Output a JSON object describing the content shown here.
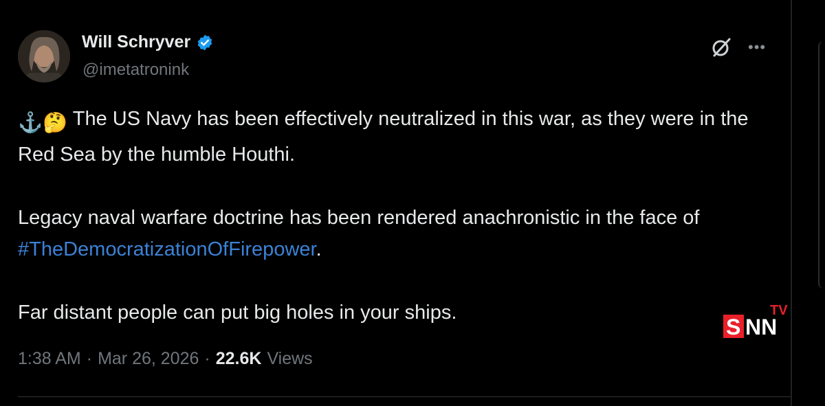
{
  "author": {
    "display_name": "Will Schryver",
    "handle": "@imetatronink",
    "verified_color": "#1d9bf0"
  },
  "tweet": {
    "lead_emojis": "⚓🤔",
    "paragraph1_text": " The US Navy has been effectively neutralized in this war, as they were in the Red Sea by the humble Houthi.",
    "paragraph2_before": "Legacy naval warfare doctrine has been rendered anachronistic in the face of ",
    "paragraph2_hashtag": "#TheDemocratizationOfFirepower",
    "paragraph2_after": ".",
    "paragraph3": "Far distant people can put big holes in your ships."
  },
  "meta": {
    "time": "1:38 AM",
    "separator": "·",
    "date": "Mar 26, 2026",
    "views_count": "22.6K",
    "views_label": "Views"
  },
  "watermark": {
    "brand": "SNN",
    "sub": "TV",
    "color_red": "#e8202a"
  },
  "icons": {
    "grok": "grok-icon",
    "more": "more-options-icon",
    "verified": "verified-badge-icon"
  },
  "colors": {
    "background": "#000000",
    "text": "#e7e9ea",
    "muted": "#71767b",
    "link": "#3b82d6"
  }
}
